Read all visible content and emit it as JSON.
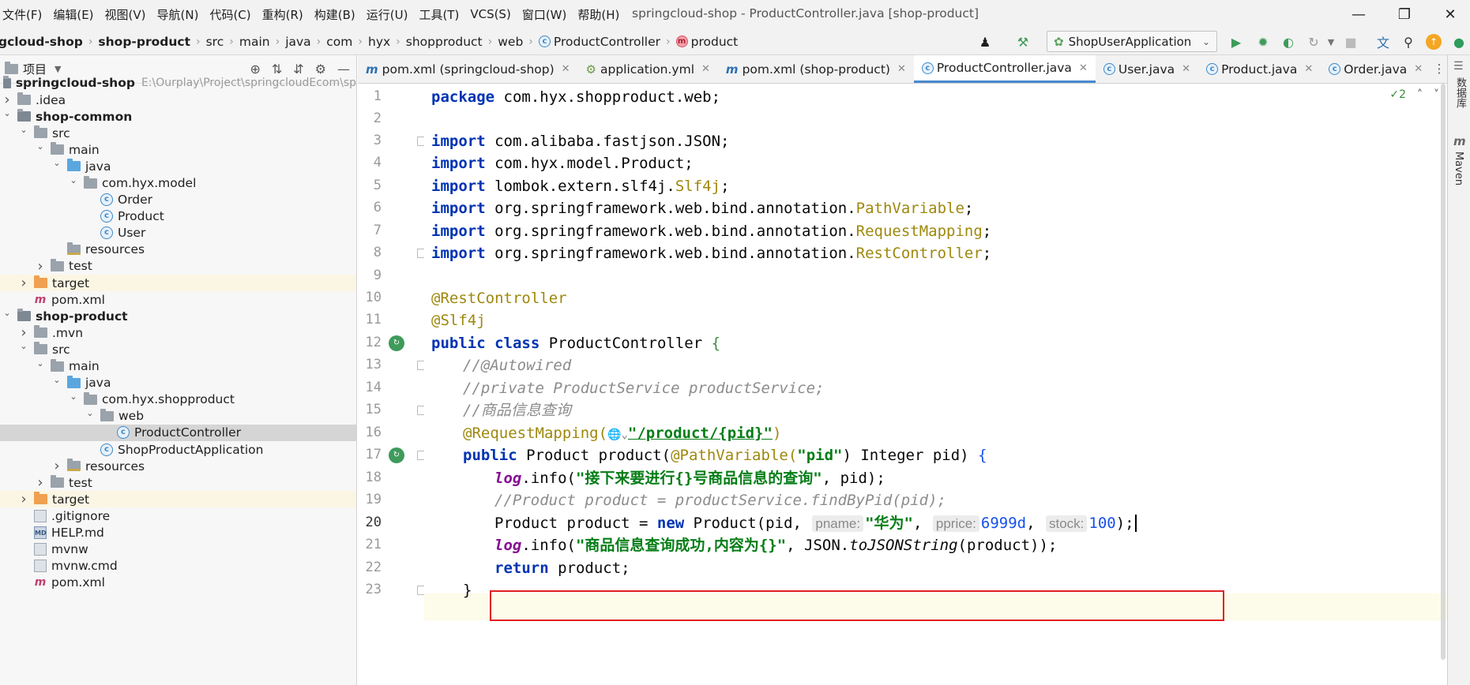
{
  "menubar": {
    "items": [
      "文件(F)",
      "编辑(E)",
      "视图(V)",
      "导航(N)",
      "代码(C)",
      "重构(R)",
      "构建(B)",
      "运行(U)",
      "工具(T)",
      "VCS(S)",
      "窗口(W)",
      "帮助(H)"
    ],
    "window_title": "springcloud-shop - ProductController.java [shop-product]"
  },
  "navbar": {
    "crumbs": [
      "gcloud-shop",
      "shop-product",
      "src",
      "main",
      "java",
      "com",
      "hyx",
      "shopproduct",
      "web",
      "ProductController",
      "product"
    ],
    "run_config": "ShopUserApplication"
  },
  "project": {
    "title": "项目",
    "root_name": "springcloud-shop",
    "root_path": "E:\\Ourplay\\Project\\springcloudEcom\\sp",
    "tree": [
      {
        "label": ".idea",
        "depth": 0,
        "chev": "closed",
        "icon": "folder"
      },
      {
        "label": "shop-common",
        "depth": 0,
        "chev": "open",
        "icon": "module",
        "bold": true
      },
      {
        "label": "src",
        "depth": 1,
        "chev": "open",
        "icon": "folder"
      },
      {
        "label": "main",
        "depth": 2,
        "chev": "open",
        "icon": "folder"
      },
      {
        "label": "java",
        "depth": 3,
        "chev": "open",
        "icon": "blue"
      },
      {
        "label": "com.hyx.model",
        "depth": 4,
        "chev": "open",
        "icon": "pkg"
      },
      {
        "label": "Order",
        "depth": 5,
        "chev": "none",
        "icon": "java"
      },
      {
        "label": "Product",
        "depth": 5,
        "chev": "none",
        "icon": "java"
      },
      {
        "label": "User",
        "depth": 5,
        "chev": "none",
        "icon": "java"
      },
      {
        "label": "resources",
        "depth": 3,
        "chev": "none",
        "icon": "res"
      },
      {
        "label": "test",
        "depth": 2,
        "chev": "closed",
        "icon": "folder"
      },
      {
        "label": "target",
        "depth": 1,
        "chev": "closed",
        "icon": "orange",
        "excl": true
      },
      {
        "label": "pom.xml",
        "depth": 1,
        "chev": "none",
        "icon": "mvn"
      },
      {
        "label": "shop-product",
        "depth": 0,
        "chev": "open",
        "icon": "module",
        "bold": true
      },
      {
        "label": ".mvn",
        "depth": 1,
        "chev": "closed",
        "icon": "folder"
      },
      {
        "label": "src",
        "depth": 1,
        "chev": "open",
        "icon": "folder"
      },
      {
        "label": "main",
        "depth": 2,
        "chev": "open",
        "icon": "folder"
      },
      {
        "label": "java",
        "depth": 3,
        "chev": "open",
        "icon": "blue"
      },
      {
        "label": "com.hyx.shopproduct",
        "depth": 4,
        "chev": "open",
        "icon": "pkg"
      },
      {
        "label": "web",
        "depth": 5,
        "chev": "open",
        "icon": "pkg"
      },
      {
        "label": "ProductController",
        "depth": 6,
        "chev": "none",
        "icon": "java",
        "sel": true
      },
      {
        "label": "ShopProductApplication",
        "depth": 5,
        "chev": "none",
        "icon": "java"
      },
      {
        "label": "resources",
        "depth": 3,
        "chev": "closed",
        "icon": "res"
      },
      {
        "label": "test",
        "depth": 2,
        "chev": "closed",
        "icon": "folder"
      },
      {
        "label": "target",
        "depth": 1,
        "chev": "closed",
        "icon": "orange",
        "excl": true
      },
      {
        "label": ".gitignore",
        "depth": 1,
        "chev": "none",
        "icon": "txt"
      },
      {
        "label": "HELP.md",
        "depth": 1,
        "chev": "none",
        "icon": "md"
      },
      {
        "label": "mvnw",
        "depth": 1,
        "chev": "none",
        "icon": "txt"
      },
      {
        "label": "mvnw.cmd",
        "depth": 1,
        "chev": "none",
        "icon": "txt"
      },
      {
        "label": "pom.xml",
        "depth": 1,
        "chev": "none",
        "icon": "mvn"
      }
    ]
  },
  "tabs": [
    {
      "label": "pom.xml (springcloud-shop)",
      "icon": "m",
      "active": false
    },
    {
      "label": "application.yml",
      "icon": "yml",
      "active": false
    },
    {
      "label": "pom.xml (shop-product)",
      "icon": "m",
      "active": false
    },
    {
      "label": "ProductController.java",
      "icon": "c",
      "active": true
    },
    {
      "label": "User.java",
      "icon": "c",
      "active": false
    },
    {
      "label": "Product.java",
      "icon": "c",
      "active": false
    },
    {
      "label": "Order.java",
      "icon": "c",
      "active": false
    }
  ],
  "editor": {
    "inspection_count": "2",
    "line_numbers": [
      "1",
      "2",
      "3",
      "4",
      "5",
      "6",
      "7",
      "8",
      "9",
      "10",
      "11",
      "12",
      "13",
      "14",
      "15",
      "16",
      "17",
      "18",
      "19",
      "20",
      "21",
      "22",
      "23"
    ],
    "code": {
      "l1_kw": "package",
      "l1_rest": " com.hyx.shopproduct.web;",
      "import_kw": "import",
      "l3_rest": " com.alibaba.fastjson.JSON;",
      "l4_rest": " com.hyx.model.Product;",
      "l5_a": " lombok.extern.slf4j.",
      "l5_b": "Slf4j",
      "l5_c": ";",
      "l6_a": " org.springframework.web.bind.annotation.",
      "l6_b": "PathVariable",
      "l6_c": ";",
      "l7_a": " org.springframework.web.bind.annotation.",
      "l7_b": "RequestMapping",
      "l7_c": ";",
      "l8_a": " org.springframework.web.bind.annotation.",
      "l8_b": "RestController",
      "l8_c": ";",
      "l10": "@RestController",
      "l11": "@Slf4j",
      "l12_kw": "public class",
      "l12_rest": " ProductController ",
      "l12_brace": "{",
      "l13": "//@Autowired",
      "l14": "//private ProductService productService;",
      "l15": "//商品信息查询",
      "l16_ann": "@RequestMapping(",
      "l16_str": "\"/product/{pid}\"",
      "l16_end": ")",
      "l17_kw": "public",
      "l17_a": " Product product(",
      "l17_ann": "@PathVariable(",
      "l17_str": "\"pid\"",
      "l17_b": ") Integer pid) ",
      "l17_brace": "{",
      "log": "log",
      "l18_a": ".info(",
      "l18_str": "\"接下来要进行{}号商品信息的查询\"",
      "l18_b": ", pid);",
      "l19": "//Product product = productService.findByPid(pid);",
      "l20_a": "Product product = ",
      "l20_kw": "new",
      "l20_b": " Product(pid, ",
      "hint_pname": "pname:",
      "l20_str": "\"华为\"",
      "l20_c": ", ",
      "hint_pprice": "pprice:",
      "l20_num1": "6999d",
      "l20_d": ", ",
      "hint_stock": "stock:",
      "l20_num2": "100",
      "l20_e": ");",
      "l21_a": ".info(",
      "l21_str": "\"商品信息查询成功,内容为{}\"",
      "l21_b": ", JSON.",
      "l21_it": "toJSONString",
      "l21_c": "(product));",
      "l22_kw": "return",
      "l22_rest": " product;",
      "l23": "}"
    }
  },
  "rightstrip": {
    "db_label": "数据库",
    "maven_label": "Maven"
  }
}
